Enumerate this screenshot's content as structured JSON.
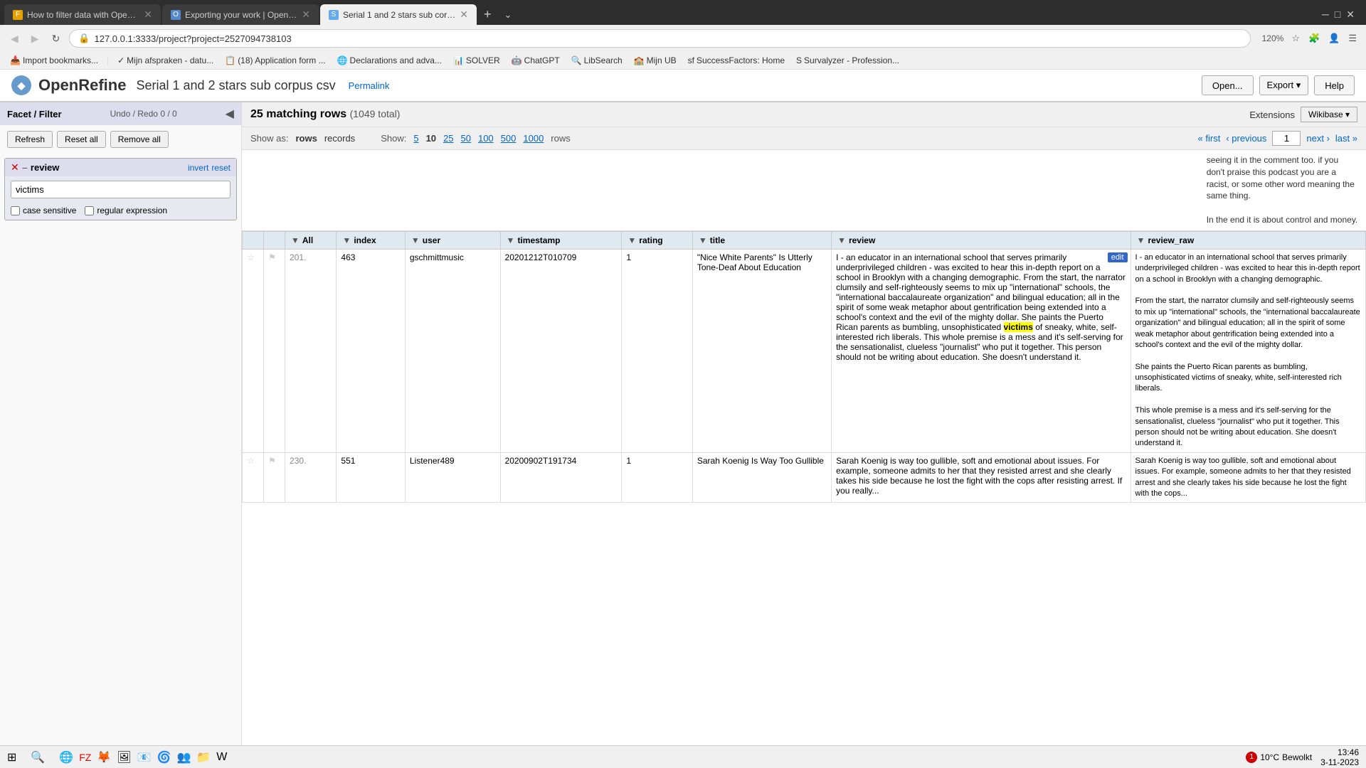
{
  "browser": {
    "tabs": [
      {
        "id": "tab1",
        "title": "How to filter data with Open R...",
        "active": false,
        "favicon": "F"
      },
      {
        "id": "tab2",
        "title": "Exporting your work | OpenRef...",
        "active": false,
        "favicon": "O"
      },
      {
        "id": "tab3",
        "title": "Serial 1 and 2 stars sub corpus...",
        "active": true,
        "favicon": "S"
      }
    ],
    "address": "127.0.0.1:3333/project?project=2527094738103",
    "zoom": "120%",
    "bookmarks": [
      "Import bookmarks...",
      "Mijn afspraken - datu...",
      "(18) Application form ...",
      "Declarations and adva...",
      "SOLVER",
      "ChatGPT",
      "LibSearch",
      "Mijn UB",
      "SuccessFactors: Home",
      "Survalyzer - Profession..."
    ]
  },
  "app": {
    "logo": "◆",
    "title": "OpenRefine",
    "project_name": "Serial 1 and 2 stars sub corpus csv",
    "permalink_label": "Permalink",
    "btn_open": "Open...",
    "btn_export": "Export ▾",
    "btn_help": "Help"
  },
  "sidebar": {
    "facet_filter_label": "Facet / Filter",
    "undo_redo_label": "Undo / Redo",
    "undo_redo_count": "0 / 0",
    "btn_refresh": "Refresh",
    "btn_reset_all": "Reset all",
    "btn_remove_all": "Remove all",
    "facet": {
      "name": "review",
      "invert_label": "invert",
      "reset_label": "reset",
      "search_value": "victims",
      "case_sensitive_label": "case sensitive",
      "regex_label": "regular expression"
    }
  },
  "content": {
    "matching_rows_label": "25 matching rows",
    "total_label": "(1049 total)",
    "extensions_label": "Extensions",
    "wikibase_label": "Wikibase ▾",
    "show_as_label": "Show as:",
    "mode_rows": "rows",
    "mode_records": "records",
    "show_label": "Show:",
    "counts": [
      "5",
      "10",
      "25",
      "50",
      "100",
      "500",
      "1000"
    ],
    "active_count": "10",
    "rows_label": "rows",
    "pagination": {
      "first": "« first",
      "previous": "‹ previous",
      "next": "next ›",
      "last": "last »",
      "current_page": "1"
    },
    "columns": [
      {
        "id": "all",
        "label": "All"
      },
      {
        "id": "index",
        "label": "index"
      },
      {
        "id": "user",
        "label": "user"
      },
      {
        "id": "timestamp",
        "label": "timestamp"
      },
      {
        "id": "rating",
        "label": "rating"
      },
      {
        "id": "title",
        "label": "title"
      },
      {
        "id": "review",
        "label": "review"
      },
      {
        "id": "review_raw",
        "label": "review_raw"
      }
    ],
    "rows": [
      {
        "row_num": "201.",
        "index": "463",
        "user": "gschmittmusic",
        "timestamp": "20201212T010709",
        "rating": "1",
        "title": "\"Nice White Parents\" Is Utterly Tone-Deaf About Education",
        "review": "I - an educator in an international school that serves primarily underprivileged children - was excited to hear this in-depth report on a school in Brooklyn with a changing demographic. From the start, the narrator clumsily and self-righteously seems to mix up \"international\" schools, the \"international baccalaureate organization\" and bilingual education; all in the spirit of some weak metaphor about gentrification being extended into a school's context and the evil of the mighty dollar. She paints the Puerto Rican parents as bumbling, unsophisticated victims of sneaky, white, self-interested rich liberals. This whole premise is a mess and it's self-serving for the sensationalist, clueless \"journalist\" who put it together. This person should not be writing about education. She doesn't understand it.",
        "review_raw": "I - an educator in an international school that serves primarily underprivileged children - was excited to hear this in-depth report on a school in Brooklyn with a changing demographic.\n\nFrom the start, the narrator clumsily and self-righteously seems to mix up \"international\" schools, the \"international baccalaureate organization\" and bilingual education; all in the spirit of some weak metaphor about gentrification being extended into a school's context and the evil of the mighty dollar.\n\nShe paints the Puerto Rican parents as bumbling, unsophisticated victims of sneaky, white, self-interested rich liberals.\n\nThis whole premise is a mess and it's self-serving for the sensationalist, clueless \"journalist\" who put it together. This person should not be writing about education. She doesn't understand it.",
        "highlighted_word": "victims",
        "has_edit": true
      },
      {
        "row_num": "230.",
        "index": "551",
        "user": "Listener489",
        "timestamp": "20200902T191734",
        "rating": "1",
        "title": "Sarah Koenig Is Way Too Gullible",
        "review": "Sarah Koenig is way too gullible, soft and emotional about issues. For example, someone admits to her that they resisted arrest and she clearly takes his side because he lost the fight with the cops after resisting arrest. If you really...",
        "review_raw": "Sarah Koenig is way too gullible, soft and emotional about issues. For example, someone admits to her that they resisted arrest and she clearly takes his side because he lost the fight with the cops...",
        "highlighted_word": "",
        "has_edit": false
      }
    ],
    "pre_row_text": "seeing it in the comment too. if you don't praise this podcast you are a racist, or some other word meaning the same thing.\n\nIn the end it is about control and money."
  },
  "status_bar": {
    "time": "13:46",
    "date": "3-11-2023",
    "temp": "10°C",
    "weather": "Bewolkt",
    "notification_count": "1"
  }
}
